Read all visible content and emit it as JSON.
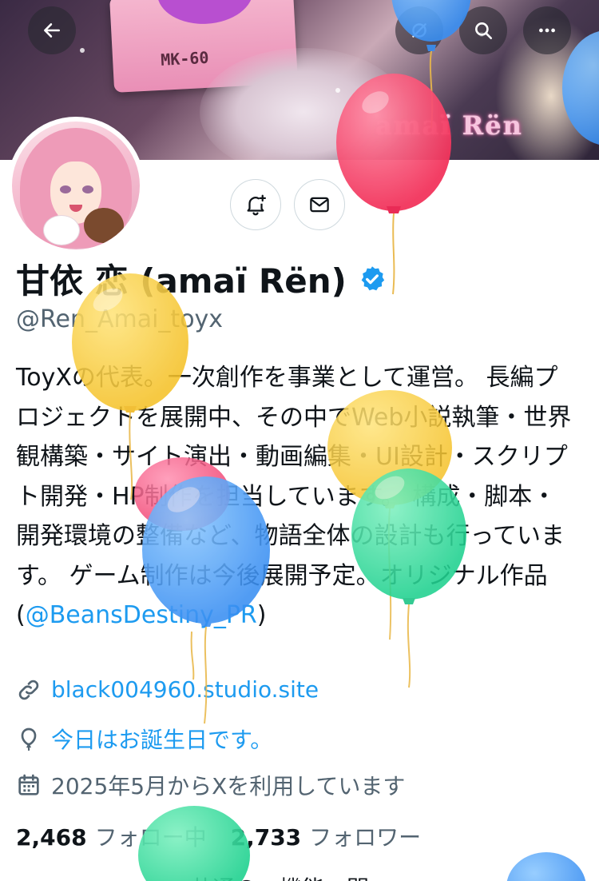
{
  "header": {
    "back_icon": "arrow-left-icon",
    "grok_icon": "grok-icon",
    "search_icon": "search-icon",
    "more_icon": "more-horizontal-icon"
  },
  "banner": {
    "cassette_label": "МК-60",
    "wordmark": "amaï Rën"
  },
  "actions": {
    "notify_icon": "bell-plus-icon",
    "message_icon": "mail-icon"
  },
  "profile": {
    "display_name": "甘依 恋 (amaï Rën)",
    "handle": "@Ren_Amai_toyx",
    "bio_text": "ToyXの代表。一次創作を事業として運営。 長編プロジェクトを展開中、その中でWeb小説執筆・世界観構築・サイト演出・動画編集・UI設計・スクリプト開発・HP制作を担当しています。 構成・脚本・開発環境の整備など、物語全体の設計も行っています。 ゲーム制作は今後展開予定。オリジナル作品\n(",
    "bio_mention": "@BeansDestiny_PR",
    "bio_close": ")",
    "website": "black004960.studio.site",
    "birthday": "今日はお誕生日です。",
    "joined": "2025年5月からXを利用しています"
  },
  "stats": {
    "following_count": "2,468",
    "following_label": "フォロー中",
    "followers_count": "2,733",
    "followers_label": "フォロワー"
  },
  "peek_text": "…共通の…機能…関…",
  "colors": {
    "accent": "#1d9bf0",
    "text": "#0f1419",
    "muted": "#536471",
    "border": "#cfd9de"
  }
}
